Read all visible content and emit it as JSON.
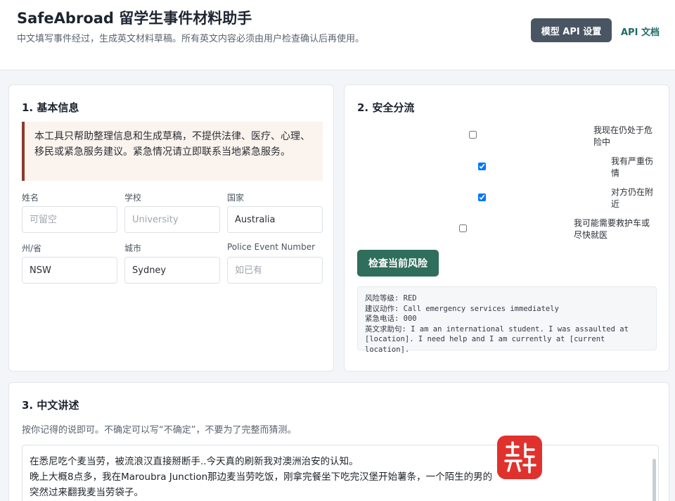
{
  "header": {
    "title": "SafeAbroad 留学生事件材料助手",
    "subtitle": "中文填写事件经过，生成英文材料草稿。所有英文内容必须由用户检查确认后再使用。",
    "settings_button": "模型 API 设置",
    "docs_link": "API 文档"
  },
  "basic_info": {
    "title": "1. 基本信息",
    "notice": "本工具只帮助整理信息和生成草稿，不提供法律、医疗、心理、移民或紧急服务建议。紧急情况请立即联系当地紧急服务。",
    "fields": {
      "name": {
        "label": "姓名",
        "value": "",
        "placeholder": "可留空"
      },
      "school": {
        "label": "学校",
        "value": "",
        "placeholder": "University"
      },
      "country": {
        "label": "国家",
        "value": "Australia",
        "placeholder": ""
      },
      "state": {
        "label": "州/省",
        "value": "NSW",
        "placeholder": ""
      },
      "city": {
        "label": "城市",
        "value": "Sydney",
        "placeholder": ""
      },
      "police_number": {
        "label": "Police Event Number",
        "value": "",
        "placeholder": "如已有"
      }
    }
  },
  "triage": {
    "title": "2. 安全分流",
    "options": [
      {
        "label": "我现在仍处于危险中",
        "checked": false
      },
      {
        "label": "我有严重伤情",
        "checked": true
      },
      {
        "label": "对方仍在附近",
        "checked": true
      },
      {
        "label": "我可能需要救护车或尽快就医",
        "checked": false
      }
    ],
    "check_button": "检查当前风险",
    "result": {
      "risk_level": "风险等级: RED",
      "action": "建议动作: Call emergency services immediately",
      "phone": "紧急电话: 000",
      "english_help": "英文求助句: I am an international student. I was assaulted at [location]. I need help and I am currently at [current location]."
    }
  },
  "narrative": {
    "title": "3. 中文讲述",
    "hint": "按你记得的说即可。不确定可以写“不确定”，不要为了完整而猜测。",
    "lines": [
      "在悉尼吃个麦当劳，被流浪汉直接掰断手..今天真的刷新我对澳洲治安的认知。",
      "晚上大概8点多，我在Maroubra Junction那边麦当劳吃饭，刚拿完餐坐下吃完汉堡开始薯条，一个陌生的男的",
      "突然过来翻我麦当劳袋子。"
    ]
  }
}
